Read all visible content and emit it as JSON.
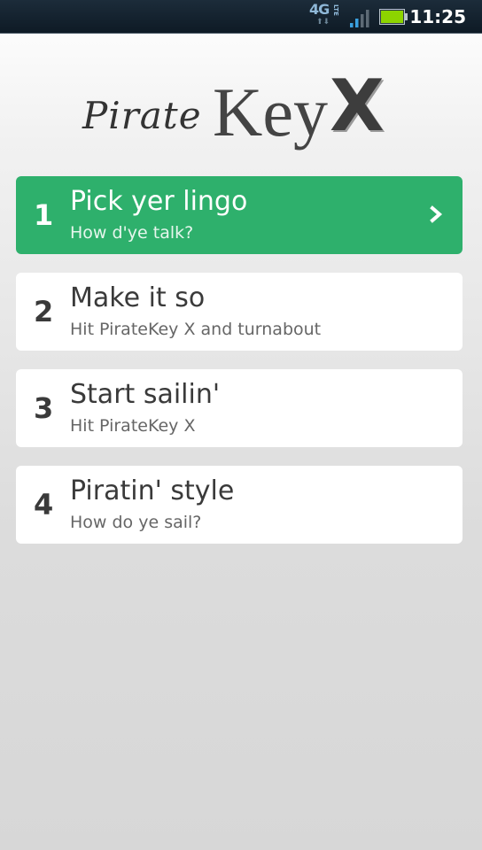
{
  "status_bar": {
    "network_label": "4G",
    "network_sub": "LTE",
    "data_arrows": "⬆⬇",
    "time": "11:25",
    "icons": [
      "4g-lte-icon",
      "signal-icon",
      "battery-icon"
    ],
    "battery_color": "#8dd400",
    "signal_color": "#3aa0e0"
  },
  "logo": {
    "pirate": "Pirate",
    "key": "Key",
    "x": "X"
  },
  "steps": [
    {
      "number": "1",
      "title": "Pick yer lingo",
      "subtitle": "How d'ye talk?",
      "active": true
    },
    {
      "number": "2",
      "title": "Make it so",
      "subtitle": "Hit PirateKey X and turnabout",
      "active": false
    },
    {
      "number": "3",
      "title": "Start sailin'",
      "subtitle": "Hit PirateKey X",
      "active": false
    },
    {
      "number": "4",
      "title": "Piratin' style",
      "subtitle": "How do ye sail?",
      "active": false
    }
  ],
  "colors": {
    "active_step": "#2eb06c",
    "step_background": "#ffffff",
    "text_dark": "#3a3a3a"
  }
}
